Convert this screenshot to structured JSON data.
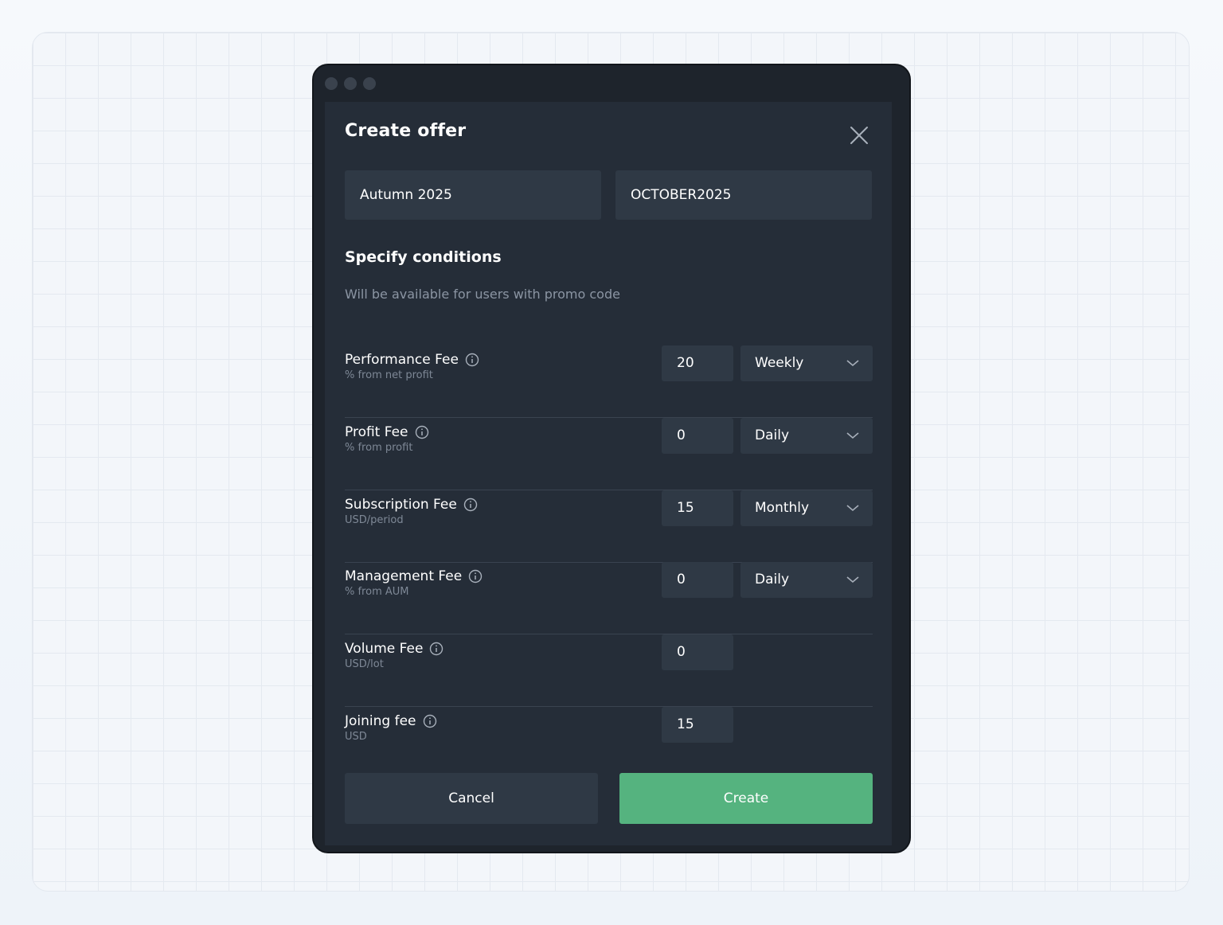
{
  "modal": {
    "title": "Create offer",
    "name_value": "Autumn 2025",
    "promo_value": "OCTOBER2025"
  },
  "conditions": {
    "title": "Specify conditions",
    "subtitle": "Will be available for users with promo code"
  },
  "fees": [
    {
      "label": "Performance Fee",
      "sub": "% from net profit",
      "value": "20",
      "period": "Weekly"
    },
    {
      "label": "Profit Fee",
      "sub": "% from profit",
      "value": "0",
      "period": "Daily"
    },
    {
      "label": "Subscription Fee",
      "sub": "USD/period",
      "value": "15",
      "period": "Monthly"
    },
    {
      "label": "Management Fee",
      "sub": "% from AUM",
      "value": "0",
      "period": "Daily"
    },
    {
      "label": "Volume Fee",
      "sub": "USD/lot",
      "value": "0"
    },
    {
      "label": "Joining fee",
      "sub": "USD",
      "value": "15"
    }
  ],
  "actions": {
    "cancel_label": "Cancel",
    "create_label": "Create"
  },
  "colors": {
    "accent": "#55b37f",
    "panel": "#252d38",
    "input": "#2f3945"
  },
  "icons": {
    "close": "close-icon",
    "info": "info-icon",
    "chevron": "chevron-down-icon"
  }
}
